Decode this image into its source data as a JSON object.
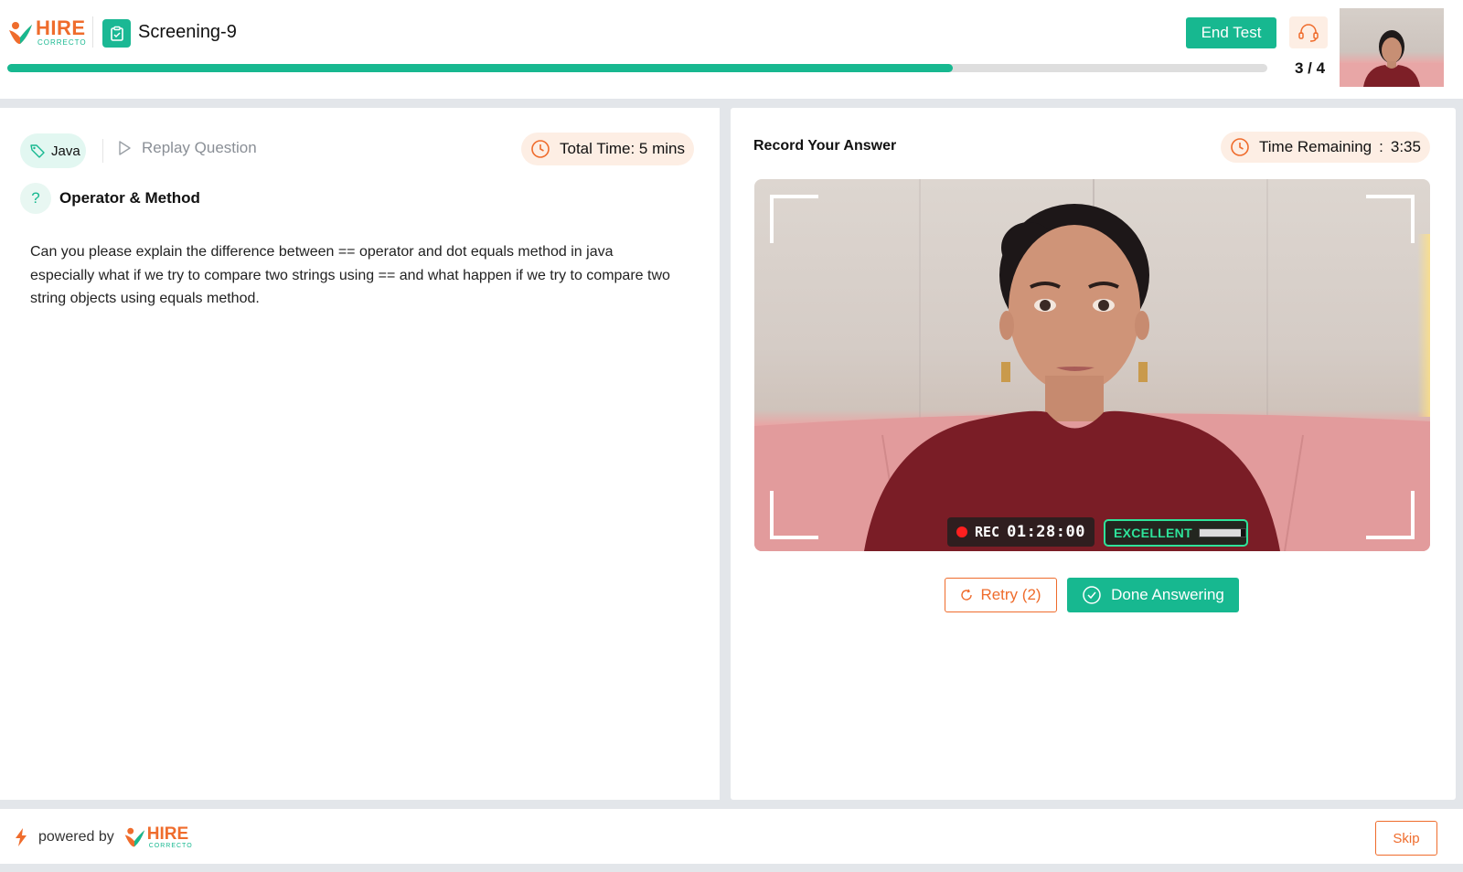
{
  "header": {
    "logo_text": "HIRE",
    "logo_subtext": "CORRECTO",
    "test_title": "Screening-9",
    "end_test_label": "End Test",
    "progress": {
      "current": 3,
      "total": 4,
      "fraction": 0.75,
      "label": "3 / 4"
    },
    "icons": {
      "logo": "hire-correcto-logo",
      "test": "clipboard-icon",
      "support": "headset-icon"
    }
  },
  "question": {
    "tag": "Java",
    "replay_label": "Replay Question",
    "total_time_label": "Total Time: 5 mins",
    "title": "Operator & Method",
    "text": "Can you please explain the difference between == operator and dot equals method in java especially what if we try to compare two strings using == and what happen if we try to compare two string objects using equals method.",
    "icons": {
      "tag": "tag-icon",
      "replay": "play-icon",
      "time": "clock-icon",
      "help": "question-icon"
    }
  },
  "recorder": {
    "title": "Record Your Answer",
    "time_remaining_label": "Time Remaining",
    "time_remaining_sep": ":",
    "time_remaining_value": "3:35",
    "rec_label": "REC",
    "rec_time": "01:28:00",
    "quality_label": "EXCELLENT",
    "quality_level": 0.9,
    "retry_label": "Retry (2)",
    "done_label": "Done Answering"
  },
  "footer": {
    "powered_by_label": "powered by",
    "logo_text": "HIRE",
    "logo_subtext": "CORRECTO",
    "skip_label": "Skip"
  },
  "colors": {
    "brand_green": "#17b890",
    "brand_orange": "#ef6c2c",
    "rec_red": "#ff1f1f",
    "quality_green": "#2ee39a"
  }
}
